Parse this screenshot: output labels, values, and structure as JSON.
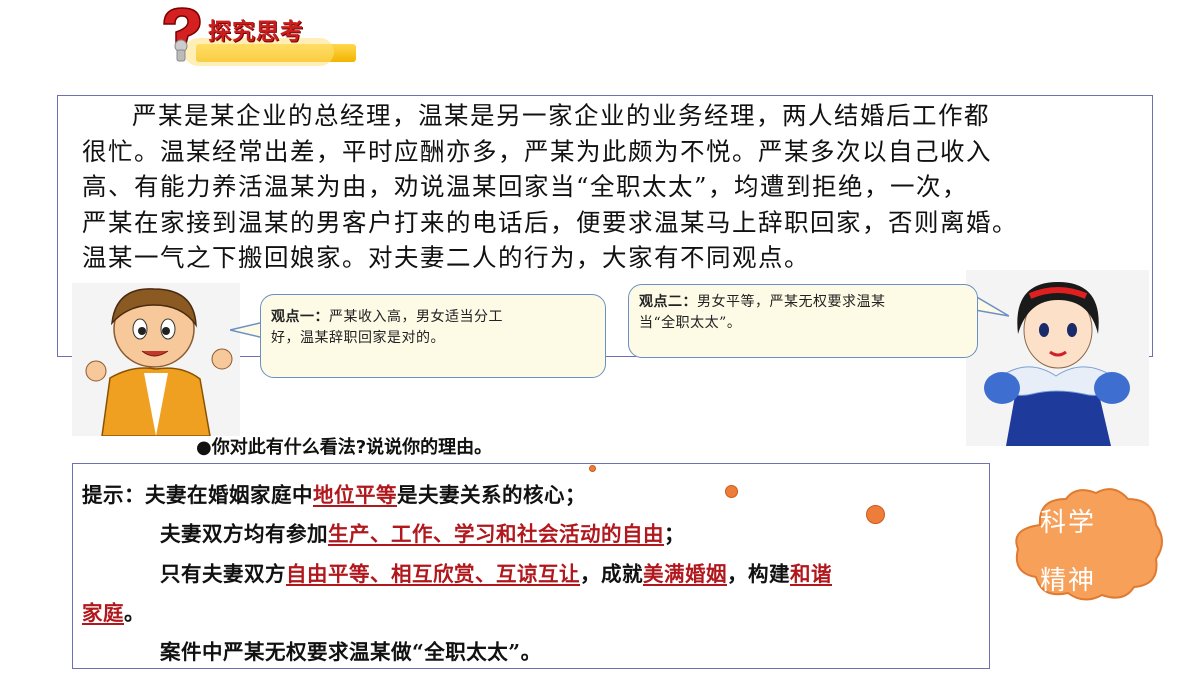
{
  "header": {
    "title": "探究思考",
    "icon": "question-mark-icon"
  },
  "story": {
    "lines": [
      "严某是某企业的总经理，温某是另一家企业的业务经理，两人结婚后工作都",
      "很忙。温某经常出差，平时应酬亦多，严某为此颇为不悦。严某多次以自己收入",
      "高、有能力养活温某为由，劝说温某回家当“全职太太”，均遭到拒绝，一次，",
      "严某在家接到温某的男客户打来的电话后，便要求温某马上辞职回家，否则离婚。",
      "温某一气之下搬回娘家。对夫妻二人的行为，大家有不同观点。"
    ]
  },
  "viewpoints": [
    {
      "label": "观点一：",
      "text": "严某收入高，男女适当分工好，温某辞职回家是对的。",
      "line1": "严某收入高，男女适当分工",
      "line2": "好，温某辞职回家是对的。"
    },
    {
      "label": "观点二：",
      "text": "男女平等，严某无权要求温某当“全职太太”。",
      "line1": "男女平等，严某无权要求温某",
      "line2": "当“全职太太”。"
    }
  ],
  "question": "●你对此有什么看法?说说你的理由。",
  "hint": {
    "l1": {
      "a": "提示：夫妻在婚姻家庭中",
      "b": "地位平等",
      "c": "是夫妻关系的核心；"
    },
    "l2": {
      "a": "夫妻双方均有参加",
      "b": "生产、工作、学习和社会活动的自由",
      "c": "；"
    },
    "l3": {
      "a": "只有夫妻双方",
      "b": "自由平等、相互欣赏、互谅互让",
      "c": "，成就",
      "d": "美满婚姻",
      "e": "，构建",
      "f": "和谐"
    },
    "l4": {
      "a": "家庭",
      "b": "。"
    },
    "l5": {
      "a": "案件中严某无权要求温某做“全职太太”。"
    }
  },
  "badge": {
    "line1": "科学",
    "line2": "精神"
  },
  "colors": {
    "highlight": "#b0181e",
    "border": "#6f6fb3",
    "cloud": "#f6a05a",
    "dot": "#ef7d3a"
  }
}
